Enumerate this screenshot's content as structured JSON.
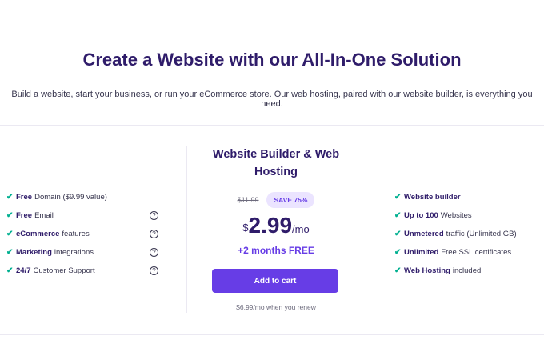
{
  "hero": {
    "title": "Create a Website with our All-In-One Solution",
    "subtitle": "Build a website, start your business, or run your eCommerce store. Our web hosting, paired with our website builder, is everything you need."
  },
  "features_left": [
    {
      "bold": "Free",
      "text": "Domain ($9.99 value)",
      "help": false
    },
    {
      "bold": "Free",
      "text": "Email",
      "help": true
    },
    {
      "bold": "eCommerce",
      "text": "features",
      "help": true
    },
    {
      "bold": "Marketing",
      "text": "integrations",
      "help": true
    },
    {
      "bold": "24/7",
      "text": "Customer Support",
      "help": true
    }
  ],
  "features_right": [
    {
      "bold": "Website builder",
      "text": ""
    },
    {
      "bold": "Up to 100",
      "text": "Websites"
    },
    {
      "bold": "Unmetered",
      "text": "traffic (Unlimited GB)"
    },
    {
      "bold": "Unlimited",
      "text": "Free SSL certificates"
    },
    {
      "bold": "Web Hosting",
      "text": "included"
    }
  ],
  "plan": {
    "name": "Website Builder & Web Hosting",
    "old_price": "$11.99",
    "save_badge": "SAVE 75%",
    "currency": "$",
    "amount": "2.99",
    "period": "/mo",
    "bonus": "+2 months FREE",
    "cta_label": "Add to cart",
    "renew_text": "$6.99/mo when you renew"
  },
  "icons": {
    "check": "check-icon",
    "help": "question-circle-icon"
  },
  "colors": {
    "brand": "#673de6",
    "heading": "#2f1c6a",
    "check": "#00b090",
    "badge_bg": "#ebe4ff"
  }
}
